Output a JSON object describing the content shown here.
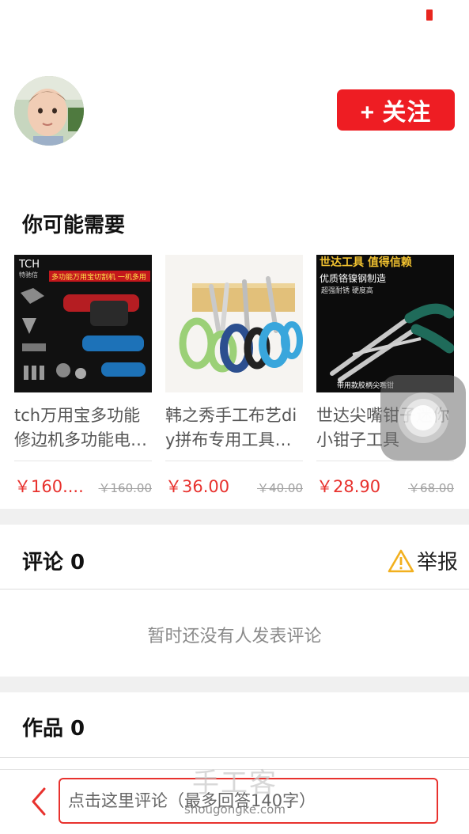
{
  "header": {
    "follow_label": "+ 关注",
    "accent_color": "#ee1d23"
  },
  "recommend": {
    "title": "你可能需要",
    "products": [
      {
        "name": "tch万用宝多功能修边机多功能电动工具",
        "price": "￥160....",
        "original_price": "￥160.00",
        "image_text": {
          "brand": "TCH",
          "brand_sub": "特驰信",
          "banner": "多功能万用宝切割机 一机多用"
        }
      },
      {
        "name": "韩之秀手工布艺diy拼布专用工具剪刀",
        "price": "￥36.00",
        "original_price": "￥40.00"
      },
      {
        "name": "世达尖嘴钳子迷你小钳子工具",
        "price": "￥28.90",
        "original_price": "￥68.00",
        "image_text": {
          "banner": "世达工具 值得信赖",
          "line1": "优质铬镍钢制造",
          "line2": "超强耐锈 硬度高",
          "line3": "带用款胶柄尖嘴钳"
        }
      }
    ]
  },
  "comments": {
    "title": "评论 0",
    "report_label": "举报",
    "empty_text": "暂时还没有人发表评论"
  },
  "works": {
    "title": "作品 0"
  },
  "bottom_bar": {
    "input_placeholder": "点击这里评论（最多回答140字）"
  },
  "watermark": {
    "big": "手工客",
    "small": "shougongke.com"
  },
  "icons": {
    "back": "chevron-left-icon",
    "report": "warning-triangle-icon",
    "assistive": "assistive-touch-icon"
  }
}
